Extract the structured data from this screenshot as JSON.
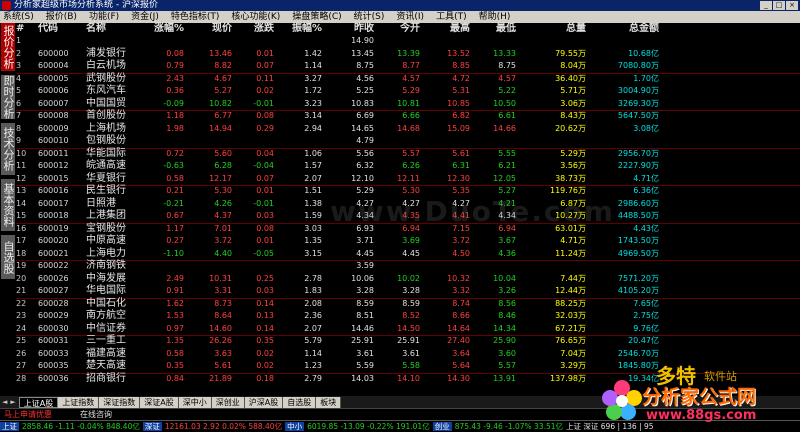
{
  "window": {
    "title": "分析家超级市场分析系统 - 沪深报价"
  },
  "menu": [
    "系统(S)",
    "报价(B)",
    "功能(F)",
    "资金(J)",
    "特色指标(T)",
    "核心功能(K)",
    "操盘策略(C)",
    "统计(S)",
    "资讯(I)",
    "工具(T)",
    "帮助(H)"
  ],
  "sidebar": [
    "报价分析",
    "即时分析",
    "技术分析",
    "基本资料",
    "自选股"
  ],
  "columns": [
    "#",
    "代码",
    "名称",
    "涨幅%",
    "现价",
    "涨跌",
    "振幅%",
    "昨收",
    "今开",
    "最高",
    "最低",
    "总量",
    "总金额"
  ],
  "rows": [
    [
      "1",
      "",
      "",
      "",
      "",
      "",
      "",
      "14.90",
      "",
      "",
      "",
      "",
      ""
    ],
    [
      "2",
      "600000",
      "浦发银行",
      "0.08",
      "13.46",
      "0.01",
      "1.42",
      "13.45",
      "13.39",
      "13.52",
      "13.33",
      "79.55万",
      "10.68亿"
    ],
    [
      "3",
      "600004",
      "白云机场",
      "0.79",
      "8.82",
      "0.07",
      "1.14",
      "8.75",
      "8.77",
      "8.85",
      "8.75",
      "8.04万",
      "7080.80万"
    ],
    [
      "4",
      "600005",
      "武钢股份",
      "2.43",
      "4.67",
      "0.11",
      "3.27",
      "4.56",
      "4.57",
      "4.72",
      "4.57",
      "36.40万",
      "1.70亿"
    ],
    [
      "5",
      "600006",
      "东风汽车",
      "0.36",
      "5.27",
      "0.02",
      "1.72",
      "5.25",
      "5.29",
      "5.31",
      "5.22",
      "5.71万",
      "3004.90万"
    ],
    [
      "6",
      "600007",
      "中国国贸",
      "-0.09",
      "10.82",
      "-0.01",
      "3.23",
      "10.83",
      "10.81",
      "10.85",
      "10.50",
      "3.06万",
      "3269.30万"
    ],
    [
      "7",
      "600008",
      "首创股份",
      "1.18",
      "6.77",
      "0.08",
      "3.14",
      "6.69",
      "6.66",
      "6.82",
      "6.61",
      "8.43万",
      "5647.50万"
    ],
    [
      "8",
      "600009",
      "上海机场",
      "1.98",
      "14.94",
      "0.29",
      "2.94",
      "14.65",
      "14.68",
      "15.09",
      "14.66",
      "20.62万",
      "3.08亿"
    ],
    [
      "9",
      "600010",
      "包钢股份",
      "",
      "",
      "",
      "",
      "4.79",
      "",
      "",
      "",
      "",
      ""
    ],
    [
      "10",
      "600011",
      "华能国际",
      "0.72",
      "5.60",
      "0.04",
      "1.06",
      "5.56",
      "5.57",
      "5.61",
      "5.55",
      "5.29万",
      "2956.70万"
    ],
    [
      "11",
      "600012",
      "皖通高速",
      "-0.63",
      "6.28",
      "-0.04",
      "1.57",
      "6.32",
      "6.26",
      "6.31",
      "6.21",
      "3.56万",
      "2227.90万"
    ],
    [
      "12",
      "600015",
      "华夏银行",
      "0.58",
      "12.17",
      "0.07",
      "2.07",
      "12.10",
      "12.11",
      "12.30",
      "12.05",
      "38.73万",
      "4.71亿"
    ],
    [
      "13",
      "600016",
      "民生银行",
      "0.21",
      "5.30",
      "0.01",
      "1.51",
      "5.29",
      "5.30",
      "5.35",
      "5.27",
      "119.76万",
      "6.36亿"
    ],
    [
      "14",
      "600017",
      "日照港",
      "-0.21",
      "4.26",
      "-0.01",
      "1.38",
      "4.27",
      "4.27",
      "4.27",
      "4.21",
      "6.87万",
      "2986.60万"
    ],
    [
      "15",
      "600018",
      "上港集团",
      "0.67",
      "4.37",
      "0.03",
      "1.59",
      "4.34",
      "4.35",
      "4.41",
      "4.34",
      "10.27万",
      "4488.50万"
    ],
    [
      "16",
      "600019",
      "宝钢股份",
      "1.17",
      "7.01",
      "0.08",
      "3.03",
      "6.93",
      "6.94",
      "7.15",
      "6.94",
      "63.01万",
      "4.43亿"
    ],
    [
      "17",
      "600020",
      "中原高速",
      "0.27",
      "3.72",
      "0.01",
      "1.35",
      "3.71",
      "3.69",
      "3.72",
      "3.67",
      "4.71万",
      "1743.50万"
    ],
    [
      "18",
      "600021",
      "上海电力",
      "-1.10",
      "4.40",
      "-0.05",
      "3.15",
      "4.45",
      "4.45",
      "4.50",
      "4.36",
      "11.24万",
      "4969.50万"
    ],
    [
      "19",
      "600022",
      "济南钢铁",
      "",
      "",
      "",
      "",
      "3.59",
      "",
      "",
      "",
      "",
      ""
    ],
    [
      "20",
      "600026",
      "中海发展",
      "2.49",
      "10.31",
      "0.25",
      "2.78",
      "10.06",
      "10.02",
      "10.32",
      "10.04",
      "7.44万",
      "7571.20万"
    ],
    [
      "21",
      "600027",
      "华电国际",
      "0.91",
      "3.31",
      "0.03",
      "1.83",
      "3.28",
      "3.28",
      "3.32",
      "3.26",
      "12.44万",
      "4105.20万"
    ],
    [
      "22",
      "600028",
      "中国石化",
      "1.62",
      "8.73",
      "0.14",
      "2.08",
      "8.59",
      "8.59",
      "8.74",
      "8.56",
      "88.25万",
      "7.65亿"
    ],
    [
      "23",
      "600029",
      "南方航空",
      "1.53",
      "8.64",
      "0.13",
      "2.36",
      "8.51",
      "8.52",
      "8.66",
      "8.46",
      "32.03万",
      "2.75亿"
    ],
    [
      "24",
      "600030",
      "中信证券",
      "0.97",
      "14.60",
      "0.14",
      "2.07",
      "14.46",
      "14.50",
      "14.64",
      "14.34",
      "67.21万",
      "9.76亿"
    ],
    [
      "25",
      "600031",
      "三一重工",
      "1.35",
      "26.26",
      "0.35",
      "5.79",
      "25.91",
      "25.91",
      "27.40",
      "25.90",
      "76.65万",
      "20.47亿"
    ],
    [
      "26",
      "600033",
      "福建高速",
      "0.58",
      "3.63",
      "0.02",
      "1.14",
      "3.61",
      "3.61",
      "3.64",
      "3.60",
      "7.04万",
      "2546.70万"
    ],
    [
      "27",
      "600035",
      "楚天高速",
      "0.35",
      "5.61",
      "0.02",
      "1.23",
      "5.59",
      "5.58",
      "5.64",
      "5.57",
      "3.29万",
      "1845.80万"
    ],
    [
      "28",
      "600036",
      "招商银行",
      "0.84",
      "21.89",
      "0.18",
      "2.79",
      "14.03",
      "14.10",
      "14.30",
      "13.91",
      "137.98万",
      "19.34亿"
    ]
  ],
  "sheet_tabs": [
    "上证A股",
    "上证指数",
    "深证指数",
    "深证A股",
    "深中小",
    "深创业",
    "沪深A股",
    "自选股",
    "板块"
  ],
  "ticker": {
    "msg": "马上申请优惠",
    "sub": "在线咨询"
  },
  "status": [
    {
      "label": "上证",
      "values": "2858.46  -1.11  -0.04%  848.40亿"
    },
    {
      "label": "深证",
      "values": "12161.03  2.92  0.02%  588.40亿"
    },
    {
      "label": "中小",
      "values": "6019.85  -13.09  -0.22%  191.01亿"
    },
    {
      "label": "创业",
      "values": "875.43  -9.46  -1.07%  33.51亿"
    },
    {
      "label": "",
      "values": "上证  深证  696  | 136 | 95"
    }
  ],
  "watermark": "www.DuoTe.com",
  "logo": {
    "brand1": "多特",
    "brand1_sub": "软件站",
    "brand2": "分析家公式网",
    "brand3": "www.88gs.com"
  },
  "colors": {
    "up": "#ff4040",
    "down": "#20d020",
    "flat": "#e0e0e0",
    "volume": "#ffff00",
    "amount": "#00e0e0",
    "header_bg": "#000000"
  }
}
